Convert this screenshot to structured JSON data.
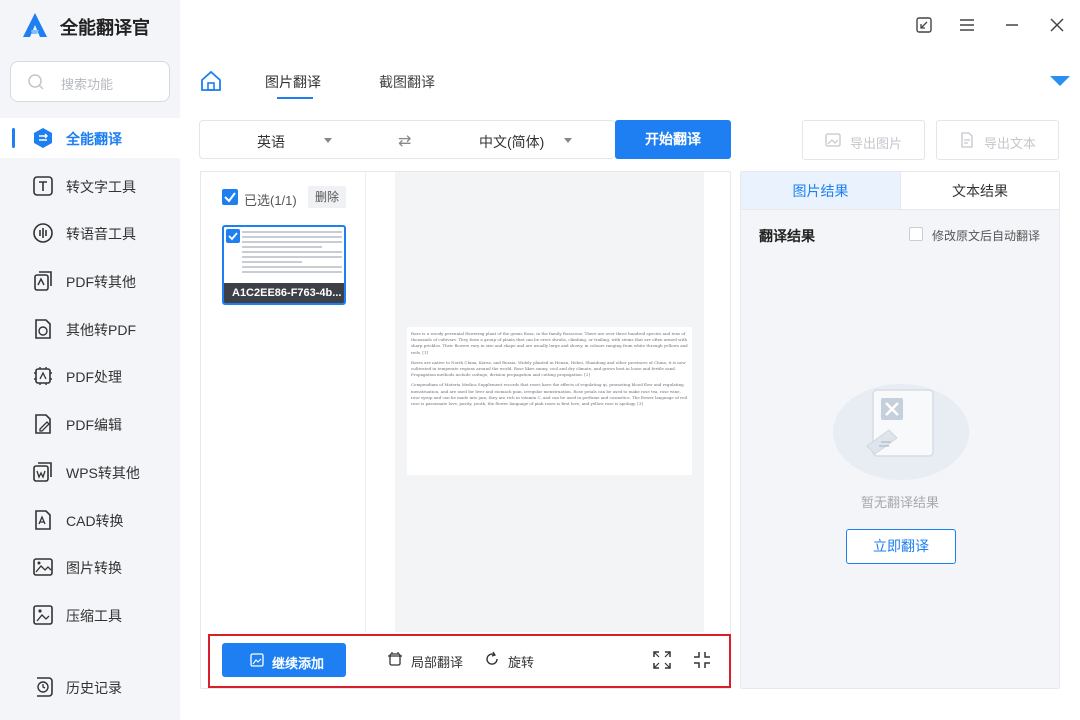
{
  "app": {
    "title": "全能翻译官"
  },
  "sidebar": {
    "search_placeholder": "搜索功能",
    "items": [
      {
        "label": "全能翻译",
        "icon": "translate-icon",
        "active": true
      },
      {
        "label": "转文字工具",
        "icon": "text-tool-icon"
      },
      {
        "label": "转语音工具",
        "icon": "voice-tool-icon"
      },
      {
        "label": "PDF转其他",
        "icon": "pdf-convert-icon"
      },
      {
        "label": "其他转PDF",
        "icon": "to-pdf-icon"
      },
      {
        "label": "PDF处理",
        "icon": "pdf-process-icon"
      },
      {
        "label": "PDF编辑",
        "icon": "pdf-edit-icon"
      },
      {
        "label": "WPS转其他",
        "icon": "wps-convert-icon"
      },
      {
        "label": "CAD转换",
        "icon": "cad-convert-icon"
      },
      {
        "label": "图片转换",
        "icon": "image-convert-icon"
      },
      {
        "label": "压缩工具",
        "icon": "compress-icon"
      }
    ],
    "history_label": "历史记录"
  },
  "tabs": [
    {
      "label": "图片翻译",
      "active": true
    },
    {
      "label": "截图翻译"
    }
  ],
  "lang_bar": {
    "source": "英语",
    "target": "中文(简体)",
    "start_label": "开始翻译"
  },
  "export": {
    "image_label": "导出图片",
    "text_label": "导出文本"
  },
  "files": {
    "selected_text": "已选(1/1)",
    "delete_label": "删除",
    "thumb_name": "A1C2EE86-F763-4b..."
  },
  "document": {
    "paragraphs": [
      "Rose is a woody perennial flowering plant of the genus Rosa, in the family Rosaceae. There are over three hundred species and tens of thousands of cultivars. They form a group of plants that can be erect shrubs, climbing, or trailing, with stems that are often armed with sharp prickles. Their flowers vary in size and shape and are usually large and showy, in colours ranging from white through yellows and reds. [1]",
      "Roses are native to North China, Korea, and Russia. Widely planted in Henan, Hebei, Shandong and other provinces of China, it is now cultivated in temperate regions around the world. Rose likes sunny, cool and dry climate, and grows best in loose and fertile sand. Propagation methods include cuttage, division propagation and cutting propagation. [2]",
      "Compendium of Materia Medica Supplement records that roses have the effects of regulating qi, promoting blood flow and regulating menstruation, and are used for liver and stomach pain, irregular menstruation. Rose petals can be used to make rose tea, rose wine, rose syrup and can be made into jam; they are rich in vitamin C, and can be used in perfume and cosmetics. The flower language of red rose is passionate love, purity, youth, the flower language of pink roses is first love, and yellow rose is apology. [3]"
    ]
  },
  "toolbar": {
    "continue_label": "继续添加",
    "partial_label": "局部翻译",
    "rotate_label": "旋转"
  },
  "result": {
    "tab_image": "图片结果",
    "tab_text": "文本结果",
    "title": "翻译结果",
    "auto_label": "修改原文后自动翻译",
    "empty_text": "暂无翻译结果",
    "translate_now": "立即翻译"
  },
  "colors": {
    "accent": "#1d7ff2",
    "highlight_box": "#d9202a"
  }
}
